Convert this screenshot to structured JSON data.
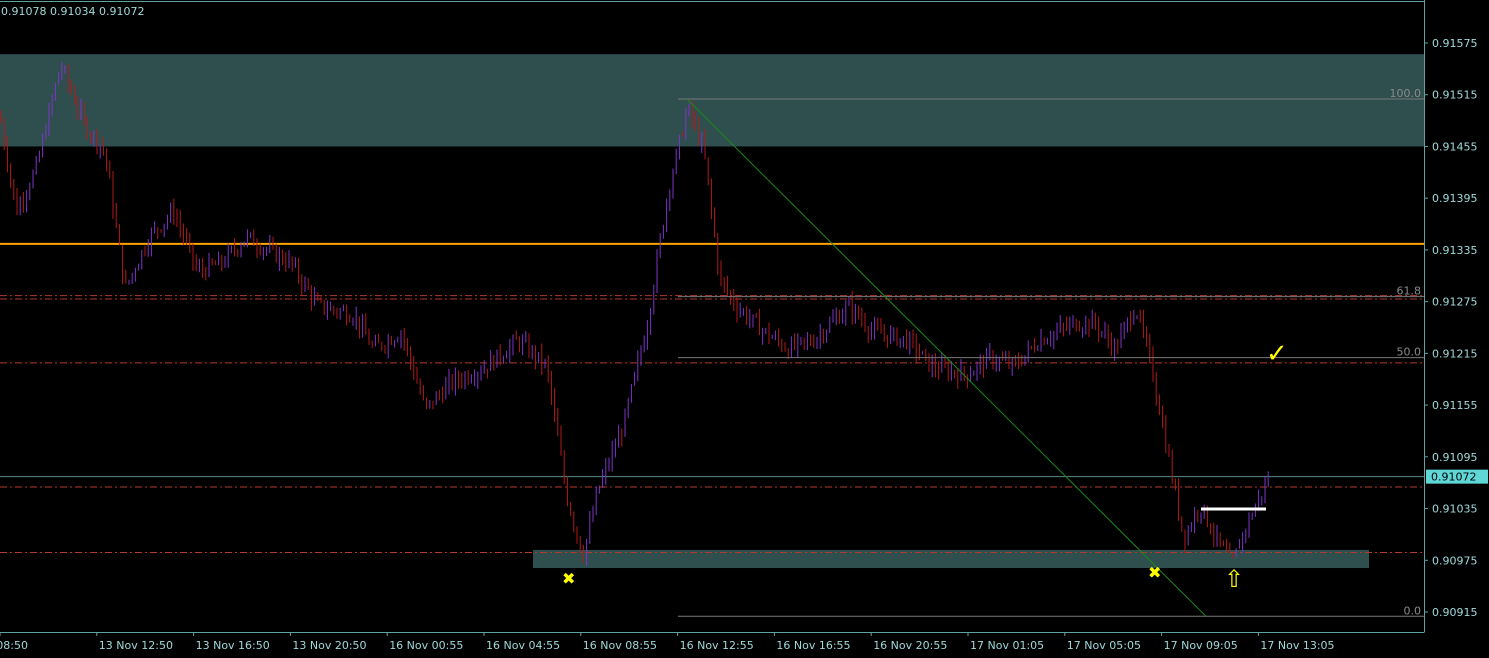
{
  "header": {
    "ohlc_text": "0.91078 0.91034 0.91072"
  },
  "chart_data": {
    "type": "candlestick",
    "symbol_readout": "0.91078 0.91034 0.91072",
    "y_ticks": [
      "0.91575",
      "0.91515",
      "0.91455",
      "0.91395",
      "0.91335",
      "0.91275",
      "0.91215",
      "0.91155",
      "0.91095",
      "0.91035",
      "0.90975",
      "0.90915"
    ],
    "x_ticks": [
      "13 Nov 08:50",
      "13 Nov 12:50",
      "13 Nov 16:50",
      "13 Nov 20:50",
      "16 Nov 00:55",
      "16 Nov 04:55",
      "16 Nov 08:55",
      "16 Nov 12:55",
      "16 Nov 16:55",
      "16 Nov 20:55",
      "17 Nov 01:05",
      "17 Nov 05:05",
      "17 Nov 09:05",
      "17 Nov 13:05"
    ],
    "current_price": "0.91072",
    "ylim": [
      0.9089,
      0.9164
    ],
    "fibonacci": {
      "high": 0.9151,
      "low": 0.9091,
      "levels": [
        {
          "label": "100.0",
          "ratio": 1.0
        },
        {
          "label": "61.8",
          "ratio": 0.618
        },
        {
          "label": "50.0",
          "ratio": 0.5
        },
        {
          "label": "0.0",
          "ratio": 0.0
        }
      ]
    },
    "zones": [
      {
        "name": "supply-zone",
        "from": 0.91455,
        "to": 0.91562
      },
      {
        "name": "demand-zone",
        "from": 0.90966,
        "to": 0.90987
      }
    ],
    "horizontal_lines": {
      "solid_orange": 0.91342,
      "dash_dot_red": [
        0.91282,
        0.91278,
        0.91204,
        0.9106,
        0.90984
      ]
    },
    "annotations": {
      "checkmark": "✓",
      "cross": "✖",
      "up_arrow": "⇧"
    },
    "price_path": [
      {
        "t": "13 Nov 08:50",
        "p": 0.9149
      },
      {
        "t": "13 Nov 09:30",
        "p": 0.9138
      },
      {
        "t": "13 Nov 10:20",
        "p": 0.9143
      },
      {
        "t": "13 Nov 11:20",
        "p": 0.9155
      },
      {
        "t": "13 Nov 12:20",
        "p": 0.9148
      },
      {
        "t": "13 Nov 13:10",
        "p": 0.9145
      },
      {
        "t": "13 Nov 14:00",
        "p": 0.9129
      },
      {
        "t": "13 Nov 15:00",
        "p": 0.9135
      },
      {
        "t": "13 Nov 16:00",
        "p": 0.9138
      },
      {
        "t": "13 Nov 17:00",
        "p": 0.9131
      },
      {
        "t": "13 Nov 18:00",
        "p": 0.9132
      },
      {
        "t": "13 Nov 19:00",
        "p": 0.9135
      },
      {
        "t": "13 Nov 20:50",
        "p": 0.9132
      },
      {
        "t": "13 Nov 22:00",
        "p": 0.9127
      },
      {
        "t": "13 Nov 23:30",
        "p": 0.9126
      },
      {
        "t": "16 Nov 00:20",
        "p": 0.9122
      },
      {
        "t": "16 Nov 01:30",
        "p": 0.9124
      },
      {
        "t": "16 Nov 02:30",
        "p": 0.9115
      },
      {
        "t": "16 Nov 03:30",
        "p": 0.9118
      },
      {
        "t": "16 Nov 05:00",
        "p": 0.912
      },
      {
        "t": "16 Nov 06:20",
        "p": 0.9123
      },
      {
        "t": "16 Nov 07:30",
        "p": 0.912
      },
      {
        "t": "16 Nov 08:20",
        "p": 0.9105
      },
      {
        "t": "16 Nov 09:00",
        "p": 0.9098
      },
      {
        "t": "16 Nov 09:40",
        "p": 0.9106
      },
      {
        "t": "16 Nov 10:40",
        "p": 0.9113
      },
      {
        "t": "16 Nov 11:40",
        "p": 0.9125
      },
      {
        "t": "16 Nov 12:30",
        "p": 0.914
      },
      {
        "t": "16 Nov 13:20",
        "p": 0.915
      },
      {
        "t": "16 Nov 14:00",
        "p": 0.9145
      },
      {
        "t": "16 Nov 14:40",
        "p": 0.913
      },
      {
        "t": "16 Nov 15:20",
        "p": 0.9127
      },
      {
        "t": "16 Nov 16:30",
        "p": 0.9124
      },
      {
        "t": "16 Nov 17:30",
        "p": 0.9122
      },
      {
        "t": "16 Nov 18:30",
        "p": 0.9123
      },
      {
        "t": "16 Nov 20:00",
        "p": 0.9127
      },
      {
        "t": "16 Nov 21:00",
        "p": 0.9124
      },
      {
        "t": "16 Nov 22:30",
        "p": 0.9123
      },
      {
        "t": "16 Nov 23:30",
        "p": 0.912
      },
      {
        "t": "17 Nov 01:00",
        "p": 0.9119
      },
      {
        "t": "17 Nov 02:00",
        "p": 0.9121
      },
      {
        "t": "17 Nov 03:00",
        "p": 0.912
      },
      {
        "t": "17 Nov 04:00",
        "p": 0.9123
      },
      {
        "t": "17 Nov 05:30",
        "p": 0.9125
      },
      {
        "t": "17 Nov 06:20",
        "p": 0.9125
      },
      {
        "t": "17 Nov 07:10",
        "p": 0.9122
      },
      {
        "t": "17 Nov 08:00",
        "p": 0.9127
      },
      {
        "t": "17 Nov 08:40",
        "p": 0.912
      },
      {
        "t": "17 Nov 09:20",
        "p": 0.911
      },
      {
        "t": "17 Nov 10:00",
        "p": 0.91
      },
      {
        "t": "17 Nov 10:40",
        "p": 0.9104
      },
      {
        "t": "17 Nov 11:20",
        "p": 0.91
      },
      {
        "t": "17 Nov 12:00",
        "p": 0.9097
      },
      {
        "t": "17 Nov 12:30",
        "p": 0.9101
      },
      {
        "t": "17 Nov 13:00",
        "p": 0.9104
      },
      {
        "t": "17 Nov 13:30",
        "p": 0.9107
      }
    ]
  },
  "colors": {
    "background": "#000000",
    "axis": "#5fa3a3",
    "grid_text": "#9fd9d9",
    "zone_fill": "#2f4f4f",
    "candle_up": "#7b35c4",
    "candle_down": "#b11a1a",
    "orange_line": "#ffa500",
    "red_dash": "#b33a2a",
    "fib_line": "#7a7a7a",
    "trend_line": "#1b8a1b",
    "current_price_box": "#5fd7d7",
    "annotation_yellow": "#ffff00",
    "white_bar": "#ffffff"
  }
}
